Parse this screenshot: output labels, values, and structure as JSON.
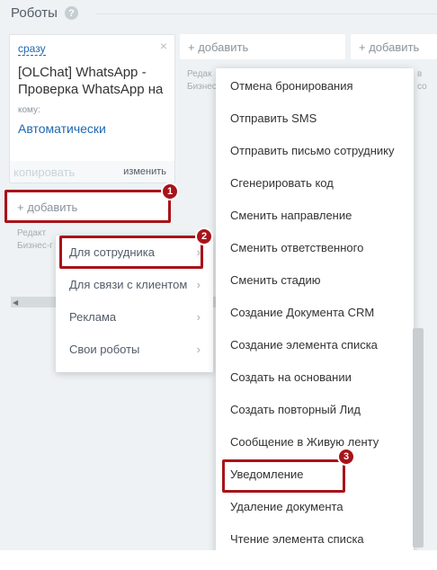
{
  "header": {
    "title": "Роботы",
    "help_icon": "?"
  },
  "card": {
    "trigger": "сразу",
    "close_icon": "×",
    "title": "[OLChat] WhatsApp - Проверка WhatsApp на",
    "to_label": "кому:",
    "to_value": "Автоматически",
    "copy_label": "копировать",
    "edit_label": "изменить"
  },
  "add_label": "+ добавить",
  "stage_labels": {
    "line1": "Редакт",
    "line2": "Бизнес-г",
    "line1_b": "Редак",
    "line2_b": "Бизнес",
    "line1_c": "в",
    "line2_c": "со"
  },
  "badges": [
    "1",
    "2",
    "3"
  ],
  "submenu": {
    "items": [
      {
        "label": "Для сотрудника",
        "chevron": "›"
      },
      {
        "label": "Для связи с клиентом",
        "chevron": "›"
      },
      {
        "label": "Реклама",
        "chevron": "›"
      },
      {
        "label": "Свои роботы",
        "chevron": "›"
      }
    ]
  },
  "main_menu": {
    "items": [
      "Отмена бронирования",
      "Отправить SMS",
      "Отправить письмо сотруднику",
      "Сгенерировать код",
      "Сменить направление",
      "Сменить ответственного",
      "Сменить стадию",
      "Создание Документа CRM",
      "Создание элемента списка",
      "Создать на основании",
      "Создать повторный Лид",
      "Сообщение в Живую ленту",
      "Уведомление",
      "Удаление документа",
      "Чтение элемента списка"
    ]
  },
  "scroll_arrow": "◀",
  "colors": {
    "accent_red": "#a8131a",
    "link_blue": "#2067b0",
    "background": "#eef2f4"
  }
}
